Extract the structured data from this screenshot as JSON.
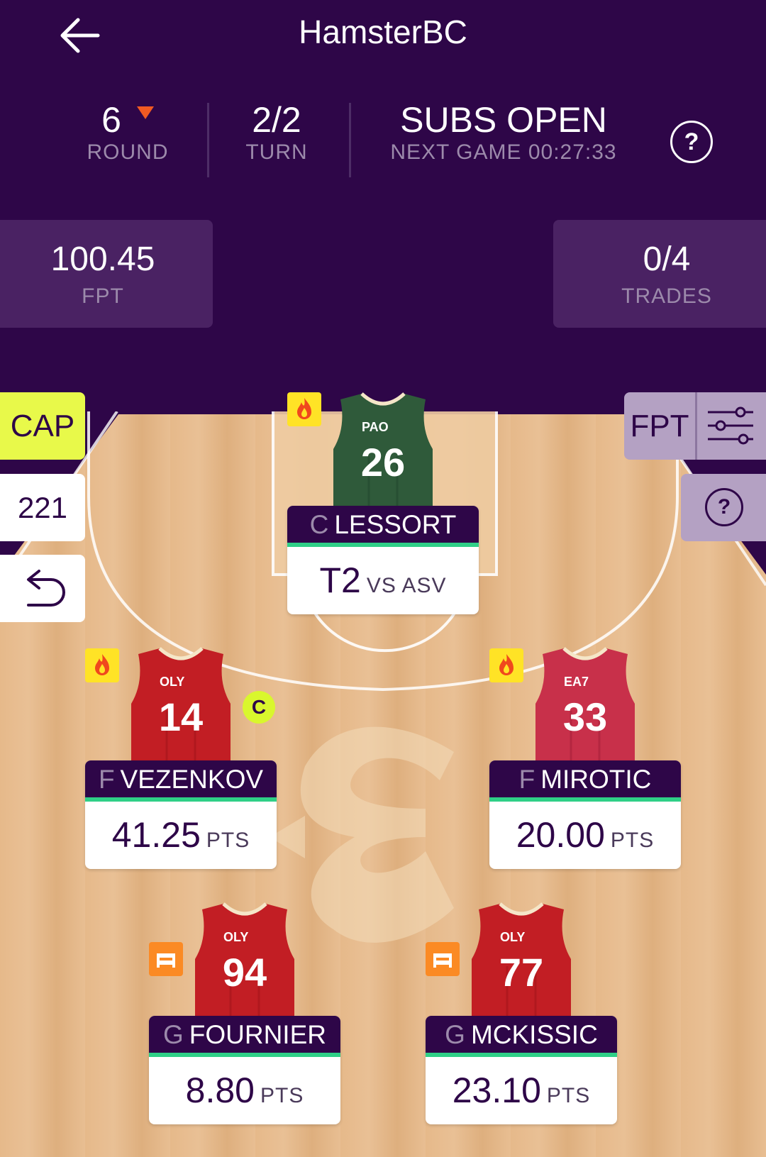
{
  "header": {
    "title": "HamsterBC",
    "round": {
      "value": "6",
      "label": "ROUND"
    },
    "turn": {
      "value": "2/2",
      "label": "TURN"
    },
    "status": {
      "value": "SUBS OPEN",
      "label": "NEXT GAME 00:27:33"
    }
  },
  "summary": {
    "fpt": {
      "value": "100.45",
      "label": "FPT"
    },
    "trades": {
      "value": "0/4",
      "label": "TRADES"
    }
  },
  "controls": {
    "cap_label": "CAP",
    "count": "221",
    "fpt_label": "FPT"
  },
  "colors": {
    "primary": "#2e0648",
    "accent_green": "#2fcf87",
    "cap_yellow": "#e8f94a",
    "fire_yellow": "#ffe326",
    "bench_orange": "#fb8a24"
  },
  "players": [
    {
      "pos": "C",
      "name": "LESSORT",
      "team": "PAO",
      "number": "26",
      "main": "T2",
      "sub": "VS ASV",
      "icon": "fire-icon"
    },
    {
      "pos": "F",
      "name": "VEZENKOV",
      "team": "OLY",
      "number": "14",
      "main": "41.25",
      "sub": "PTS",
      "icon": "fire-icon",
      "captain": "C"
    },
    {
      "pos": "F",
      "name": "MIROTIC",
      "team": "EA7",
      "number": "33",
      "main": "20.00",
      "sub": "PTS",
      "icon": "fire-icon"
    },
    {
      "pos": "G",
      "name": "FOURNIER",
      "team": "OLY",
      "number": "94",
      "main": "8.80",
      "sub": "PTS",
      "icon": "bench-icon"
    },
    {
      "pos": "G",
      "name": "MCKISSIC",
      "team": "OLY",
      "number": "77",
      "main": "23.10",
      "sub": "PTS",
      "icon": "bench-icon"
    }
  ]
}
